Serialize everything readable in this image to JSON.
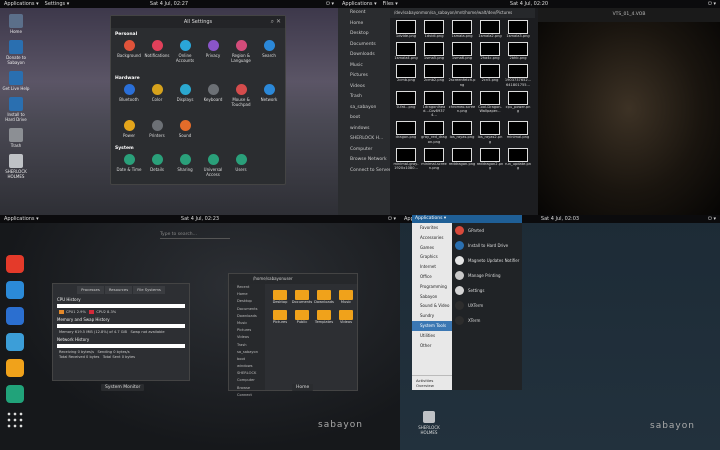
{
  "q1": {
    "topbar": {
      "apps": "Applications ▾",
      "settings": "Settings ▾",
      "clock": "Sat  4 Jul, 02:27"
    },
    "dock": [
      {
        "label": "Home",
        "color": "#5b6f8a"
      },
      {
        "label": "Donate to Sabayon",
        "color": "#2a6fb0"
      },
      {
        "label": "Get Live Help",
        "color": "#2a6fb0"
      },
      {
        "label": "Install to Hard Drive",
        "color": "#2a6fb0"
      },
      {
        "label": "Trash",
        "color": "#8c8f94"
      },
      {
        "label": "SHERLOCK HOLMES",
        "color": "#bfc2c6"
      }
    ],
    "settings": {
      "title": "All Settings",
      "personal_label": "Personal",
      "personal": [
        {
          "label": "Background",
          "color": "#e0533a"
        },
        {
          "label": "Notifications",
          "color": "#e0405a"
        },
        {
          "label": "Online Accounts",
          "color": "#2aa6d8"
        },
        {
          "label": "Privacy",
          "color": "#8a55c9"
        },
        {
          "label": "Region & Language",
          "color": "#d34c7a"
        },
        {
          "label": "Search",
          "color": "#2b88d8"
        }
      ],
      "hardware_label": "Hardware",
      "hardware": [
        {
          "label": "Bluetooth",
          "color": "#2a6fd8"
        },
        {
          "label": "Color",
          "color": "#d6a21c"
        },
        {
          "label": "Displays",
          "color": "#2ba8cf"
        },
        {
          "label": "Keyboard",
          "color": "#6c7075"
        },
        {
          "label": "Mouse & Touchpad",
          "color": "#d54c4c"
        },
        {
          "label": "Network",
          "color": "#2b88d8"
        }
      ],
      "hardware2": [
        {
          "label": "Power",
          "color": "#e4a51b"
        },
        {
          "label": "Printers",
          "color": "#6c7075"
        },
        {
          "label": "Sound",
          "color": "#e36c2a"
        }
      ],
      "system_label": "System",
      "system": [
        {
          "label": "Date & Time",
          "color": "#2aa07a"
        },
        {
          "label": "Details",
          "color": "#2aa07a"
        },
        {
          "label": "Sharing",
          "color": "#2aa07a"
        },
        {
          "label": "Universal Access",
          "color": "#2aa07a"
        },
        {
          "label": "Users",
          "color": "#2aa07a"
        }
      ]
    }
  },
  "q2": {
    "topbar": {
      "apps": "Applications ▾",
      "files": "Files ▾",
      "clock": "Sat  4 Jul, 02:20"
    },
    "path": "/dev/sabayonmon/sa_sabayon/mnt/home/walt/dev/Pictures",
    "sidebar": [
      "Recent",
      "Home",
      "Desktop",
      "Documents",
      "Downloads",
      "Music",
      "Pictures",
      "Videos",
      "Trash",
      "sa_sabayon",
      "boot",
      "windows",
      "SHERLOCK H...",
      "Computer",
      "Browse Network",
      "Connect to Server"
    ],
    "files": [
      "1dvide.png",
      "1dvidi.png",
      "1smala.png",
      "1smala2.png",
      "1smala3.png",
      "1smala4.png",
      "1sma5.png",
      "1sma6.png",
      "2ha4c.png",
      "2bhb.png",
      "2cmb.png",
      "2cmb2.png",
      "2screenfetch.png",
      "2cn5.png",
      "1903737652...641801755...",
      "0-fat...png",
      "1dragonlhead...Cov89374...",
      "chromeo.screen.png",
      "Cool-Dragon-Wallpaper...",
      "cpu_power.png",
      "dragon.png",
      "gray_red_dragon.png",
      "ios_rayas.png",
      "ios_rayas2.png",
      "minimal.png",
      "minimal-gray-1920x1080...",
      "minimal-screen.png",
      "reddragon.png",
      "reddragon2.png",
      "run_update.png"
    ],
    "video_title": "VTS_01_4.VOB"
  },
  "q3": {
    "topbar": {
      "apps": "Applications ▾",
      "clock": "Sat  4 Jul, 02:23"
    },
    "search_placeholder": "Type to search...",
    "dock_colors": [
      "#e43a2a",
      "#2b8ad8",
      "#2b6fd0",
      "#3c9ed8",
      "#f0a21b",
      "#21a37a",
      "#dddddd"
    ],
    "sysmon": {
      "tabs": [
        "Processes",
        "Resources",
        "File Systems"
      ],
      "cpu_title": "CPU History",
      "cpu1": "CPU1  2.9%",
      "cpu2": "CPU2  8.3%",
      "mem_title": "Memory and Swap History",
      "mem_line": "Memory",
      "mem_val": "619.5 MiB (12.8%) of 4.7 GiB",
      "swap_line": "Swap",
      "swap_val": "not available",
      "net_title": "Network History",
      "recv": "Receiving",
      "recv_val": "0 bytes/s",
      "recv_total": "Total Received",
      "recv_total_val": "0 bytes",
      "sent": "Sending",
      "sent_val": "0 bytes/s",
      "sent_total": "Total Sent",
      "sent_total_val": "0 bytes",
      "caption": "System Monitor"
    },
    "files": {
      "path": "/home/sabayonuser",
      "sidebar": [
        "Recent",
        "Home",
        "Desktop",
        "Documents",
        "Downloads",
        "Music",
        "Pictures",
        "Videos",
        "Trash",
        "sa_sabayon",
        "boot",
        "windows",
        "SHERLOCK",
        "Computer",
        "Browse",
        "Connect"
      ],
      "folders": [
        "Desktop",
        "Documents",
        "Downloads",
        "Music",
        "Pictures",
        "Public",
        "Templates",
        "Videos"
      ],
      "caption": "Home"
    },
    "logo": "sabayon"
  },
  "q4": {
    "topbar": {
      "apps": "Applications ▾",
      "clock": "Sat  4 Jul, 02:03"
    },
    "menu_header": "Applications ▾",
    "categories": [
      "Favorites",
      "Accessories",
      "Games",
      "Graphics",
      "Internet",
      "Office",
      "Programming",
      "Sabayon",
      "Sound & Video",
      "Sundry",
      "System Tools",
      "Utilities",
      "Other"
    ],
    "selected_category": "System Tools",
    "apps": [
      {
        "label": "GParted",
        "color": "#d94a3b"
      },
      {
        "label": "Install to Hard Drive",
        "color": "#2a6fb0"
      },
      {
        "label": "Magneto Updates Notifier",
        "color": "#e5e5e5"
      },
      {
        "label": "Manage Printing",
        "color": "#c8c8c8"
      },
      {
        "label": "Settings",
        "color": "#d5d5d5"
      },
      {
        "label": "UXTerm",
        "color": "#2d2d2d"
      },
      {
        "label": "XTerm",
        "color": "#2d2d2d"
      }
    ],
    "admin": "Activities Overview",
    "sherlock": "SHERLOCK HOLMES",
    "logo": "sabayon"
  }
}
